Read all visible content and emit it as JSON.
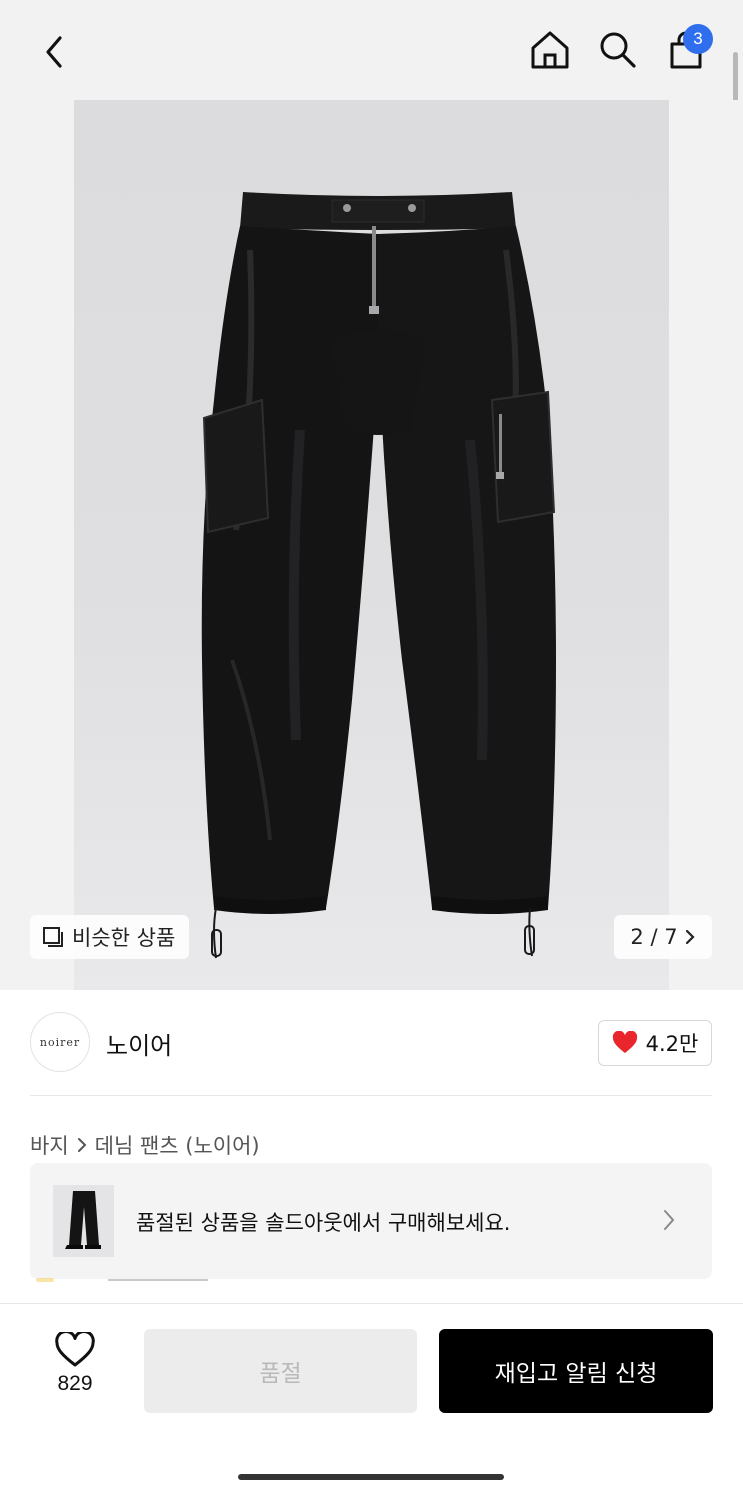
{
  "header": {
    "back_icon": "chevron-left-icon",
    "home_icon": "home-icon",
    "search_icon": "search-icon",
    "cart_icon": "shopping-bag-icon",
    "cart_count": "3",
    "badge_color": "#2f6fed"
  },
  "hero": {
    "similar_label": "비슷한 상품",
    "page_indicator": "2 / 7",
    "image_subject": "black nylon cargo pants"
  },
  "brand": {
    "logo_text": "noirer",
    "name": "노이어",
    "like_count": "4.2만",
    "heart_color": "#e8262b"
  },
  "breadcrumb": {
    "category": "바지",
    "subcategory": "데님 팬츠 (노이어)"
  },
  "banner": {
    "text": "품절된 상품을 솔드아웃에서 구매해보세요."
  },
  "bottom": {
    "wish_count": "829",
    "soldout_label": "품절",
    "restock_label": "재입고 알림 신청"
  }
}
